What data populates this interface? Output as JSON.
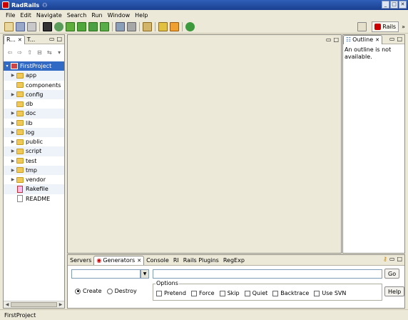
{
  "window": {
    "title": "RadRails"
  },
  "menu": [
    "File",
    "Edit",
    "Navigate",
    "Search",
    "Run",
    "Window",
    "Help"
  ],
  "perspective": {
    "rails_label": "Rails",
    "more": "»"
  },
  "explorer": {
    "tabs": [
      {
        "label": "R...",
        "active": true
      },
      {
        "label": "T..."
      }
    ],
    "items": [
      {
        "label": "FirstProject",
        "kind": "project",
        "selected": true,
        "expanded": true
      },
      {
        "label": "app",
        "kind": "folder",
        "expandable": true
      },
      {
        "label": "components",
        "kind": "folder",
        "expandable": false
      },
      {
        "label": "config",
        "kind": "folder",
        "expandable": true
      },
      {
        "label": "db",
        "kind": "folder",
        "expandable": false
      },
      {
        "label": "doc",
        "kind": "folder",
        "expandable": true
      },
      {
        "label": "lib",
        "kind": "folder",
        "expandable": true
      },
      {
        "label": "log",
        "kind": "folder",
        "expandable": true
      },
      {
        "label": "public",
        "kind": "folder",
        "expandable": true
      },
      {
        "label": "script",
        "kind": "folder",
        "expandable": true
      },
      {
        "label": "test",
        "kind": "folder",
        "expandable": true
      },
      {
        "label": "tmp",
        "kind": "folder",
        "expandable": true
      },
      {
        "label": "vendor",
        "kind": "folder",
        "expandable": true
      },
      {
        "label": "Rakefile",
        "kind": "file"
      },
      {
        "label": "README",
        "kind": "file"
      }
    ]
  },
  "outline": {
    "tab": "Outline",
    "message": "An outline is not available."
  },
  "bottom": {
    "tabs": [
      "Servers",
      "Generators",
      "Console",
      "RI",
      "Rails Plugins",
      "RegExp"
    ],
    "active_tab": "Generators",
    "go_label": "Go",
    "help_label": "Help",
    "create_label": "Create",
    "destroy_label": "Destroy",
    "options_legend": "Options",
    "options": [
      "Pretend",
      "Force",
      "Skip",
      "Quiet",
      "Backtrace",
      "Use SVN"
    ]
  },
  "status": {
    "text": "FirstProject"
  },
  "colors": {
    "selection": "#316ac5",
    "folder": "#f0c859",
    "titlebar": "#2f5fb8"
  }
}
